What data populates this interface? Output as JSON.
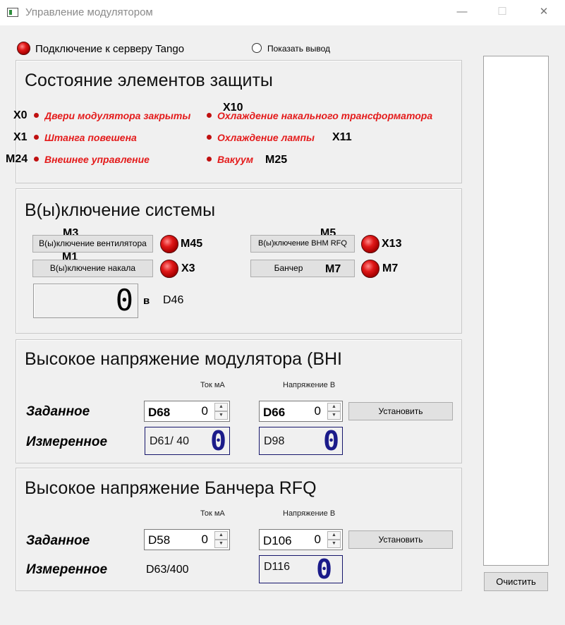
{
  "window": {
    "title": "Управление модулятором",
    "minimize_glyph": "—",
    "maximize_glyph": "☐",
    "close_glyph": "✕"
  },
  "connection": {
    "label": "Подключение к серверу Tango",
    "led_color": "#e01818"
  },
  "show_output": {
    "label": "Показать вывод",
    "checked": false
  },
  "protection": {
    "title": "Состояние элементов защиты",
    "items": [
      {
        "tag": "X0",
        "label": "Двери модулятора закрыты"
      },
      {
        "tag": "X1",
        "label": "Штанга повешена"
      },
      {
        "tag": "M24",
        "label": "Внешнее управление"
      },
      {
        "tag": "X10",
        "label": "Охлаждение накального трансформатора"
      },
      {
        "tag": "X11",
        "label": "Охлаждение лампы"
      },
      {
        "tag": "M25",
        "label": "Вакуум"
      }
    ],
    "alarm_color": "#e41b1b"
  },
  "system": {
    "title": "В(ы)ключение системы",
    "fan": {
      "tag": "M3",
      "label": "В(ы)ключение вентилятора",
      "led_tag": "M45"
    },
    "heating": {
      "tag": "M1",
      "label": "В(ы)ключение накала",
      "led_tag": "X3"
    },
    "bhm": {
      "tag": "M5",
      "label": "В(ы)ключение ВНМ RFQ",
      "led_tag": "X13"
    },
    "buncher": {
      "tag": "M7",
      "label": "Банчер",
      "led_tag": "M7"
    },
    "voltage": {
      "value": "0",
      "unit": "в",
      "tag": "D46"
    }
  },
  "modulator_hv": {
    "title": "Высокое напряжение модулятора  (ВНI",
    "col_current": "Ток мА",
    "col_voltage": "Напряжение В",
    "set_label": "Заданное",
    "meas_label": "Измеренное",
    "set_current": {
      "tag": "D68",
      "value": "0"
    },
    "set_voltage": {
      "tag": "D66",
      "value": "0"
    },
    "meas_current": {
      "tag": "D61/ 40",
      "value": "0"
    },
    "meas_voltage": {
      "tag": "D98",
      "value": "0"
    },
    "apply_label": "Установить"
  },
  "buncher_hv": {
    "title": "Высокое напряжение Банчера RFQ",
    "col_current": "Ток мА",
    "col_voltage": "Напряжение В",
    "set_label": "Заданное",
    "meas_label": "Измеренное",
    "set_current": {
      "tag": "D58",
      "value": "0"
    },
    "set_voltage": {
      "tag": "D106",
      "value": "0"
    },
    "meas_current": {
      "tag": "D63/400"
    },
    "meas_voltage": {
      "tag": "D116",
      "value": "0"
    },
    "apply_label": "Установить"
  },
  "log": {
    "clear_label": "Очистить"
  },
  "colors": {
    "lcd_blue": "#1b1b8a",
    "led_red": "#e01818"
  }
}
